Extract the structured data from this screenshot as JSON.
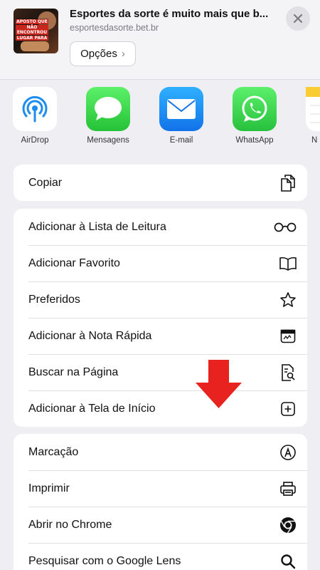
{
  "header": {
    "title": "Esportes da sorte é muito mais que b...",
    "url": "esportesdasorte.bet.br",
    "options_label": "Opções",
    "thumbnail_text": [
      "APOSTO QUE",
      "NÃO ENCONTROU",
      "LUGAR PARA"
    ]
  },
  "apps": [
    {
      "label": "AirDrop",
      "icon": "airdrop-icon"
    },
    {
      "label": "Mensagens",
      "icon": "messages-icon"
    },
    {
      "label": "E-mail",
      "icon": "mail-icon"
    },
    {
      "label": "WhatsApp",
      "icon": "whatsapp-icon"
    },
    {
      "label": "N",
      "icon": "notes-icon"
    }
  ],
  "actions": {
    "group1": [
      {
        "label": "Copiar",
        "icon": "copy-icon"
      }
    ],
    "group2": [
      {
        "label": "Adicionar à Lista de Leitura",
        "icon": "glasses-icon"
      },
      {
        "label": "Adicionar Favorito",
        "icon": "book-icon"
      },
      {
        "label": "Preferidos",
        "icon": "star-icon"
      },
      {
        "label": "Adicionar à Nota Rápida",
        "icon": "quick-note-icon"
      },
      {
        "label": "Buscar na Página",
        "icon": "find-in-page-icon"
      },
      {
        "label": "Adicionar à Tela de Início",
        "icon": "add-square-icon"
      }
    ],
    "group3": [
      {
        "label": "Marcação",
        "icon": "markup-icon"
      },
      {
        "label": "Imprimir",
        "icon": "printer-icon"
      },
      {
        "label": "Abrir no Chrome",
        "icon": "chrome-icon"
      },
      {
        "label": "Pesquisar com o Google Lens",
        "icon": "search-icon"
      }
    ]
  },
  "colors": {
    "background": "#efeef3",
    "arrow": "#e8231f",
    "whatsapp": "#27c03c",
    "mail": "#1173ea"
  }
}
